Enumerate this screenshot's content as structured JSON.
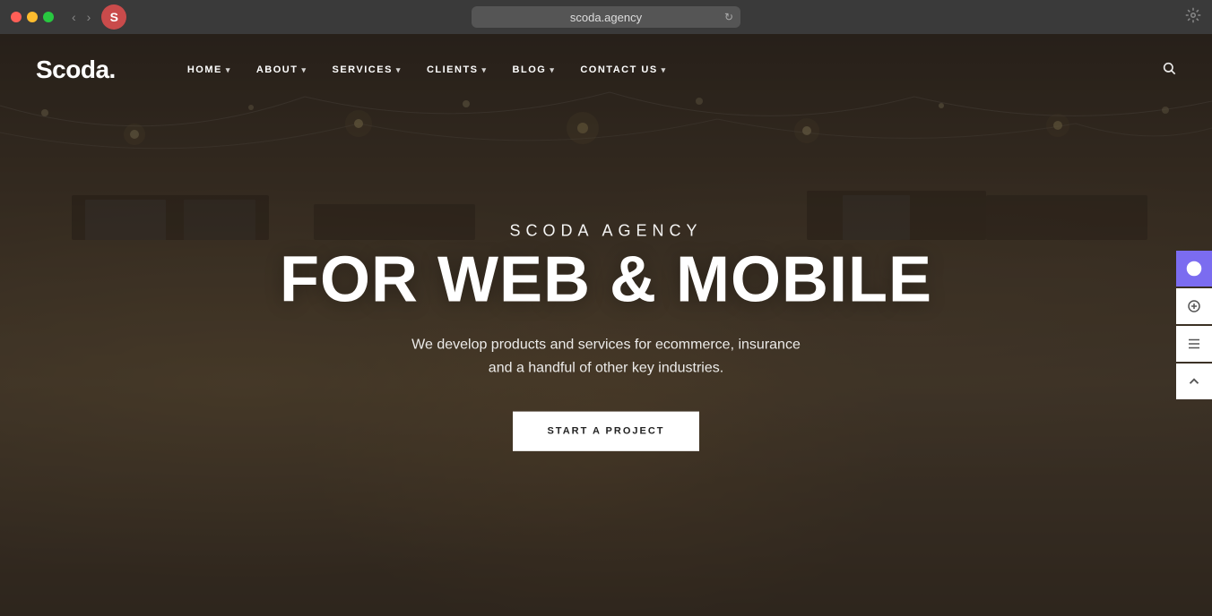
{
  "browser": {
    "url": "scoda.agency",
    "tab_icon": "S"
  },
  "site": {
    "logo": "Scoda.",
    "nav": {
      "items": [
        {
          "label": "HOME",
          "has_dropdown": true
        },
        {
          "label": "ABOUT",
          "has_dropdown": true
        },
        {
          "label": "SERVICES",
          "has_dropdown": true
        },
        {
          "label": "CLIENTS",
          "has_dropdown": true
        },
        {
          "label": "BLOG",
          "has_dropdown": true
        },
        {
          "label": "CONTACT US",
          "has_dropdown": true
        }
      ]
    },
    "hero": {
      "subtitle": "SCODA AGENCY",
      "title": "FOR WEB & MOBILE",
      "description": "We develop products and services for ecommerce, insurance\nand a handful of other key industries.",
      "cta_label": "START A PROJECT"
    },
    "sidebar": {
      "buttons": [
        {
          "icon": "target",
          "active": true
        },
        {
          "icon": "location-plus",
          "active": false
        },
        {
          "icon": "list",
          "active": false
        },
        {
          "icon": "chevron-up",
          "active": false
        }
      ]
    }
  },
  "colors": {
    "accent_purple": "#7b6cf0",
    "nav_bg": "#3a3a3a",
    "hero_overlay": "rgba(30,25,20,0.55)"
  }
}
